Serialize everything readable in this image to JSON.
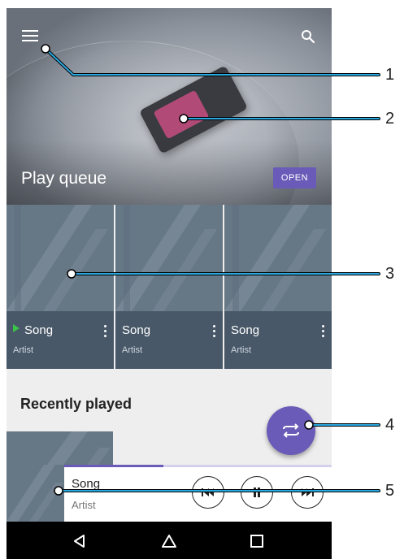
{
  "header": {
    "play_queue_title": "Play queue",
    "open_button": "OPEN"
  },
  "albums": [
    {
      "song": "Song",
      "artist": "Artist",
      "playing": true
    },
    {
      "song": "Song",
      "artist": "Artist",
      "playing": false
    },
    {
      "song": "Song",
      "artist": "Artist",
      "playing": false
    }
  ],
  "recent": {
    "title": "Recently played"
  },
  "mini_player": {
    "song": "Song",
    "artist": "Artist",
    "progress": 0.37
  },
  "callouts": [
    "1",
    "2",
    "3",
    "4",
    "5"
  ],
  "colors": {
    "accent": "#6a5bb8",
    "tile": "#485868",
    "playing_indicator": "#3bc24a",
    "callout_line": "#2aa8e0"
  },
  "icons": [
    "menu-icon",
    "search-icon",
    "more-vert-icon",
    "shuffle-icon",
    "previous-icon",
    "pause-icon",
    "next-icon",
    "back-icon",
    "home-icon",
    "recents-icon"
  ]
}
